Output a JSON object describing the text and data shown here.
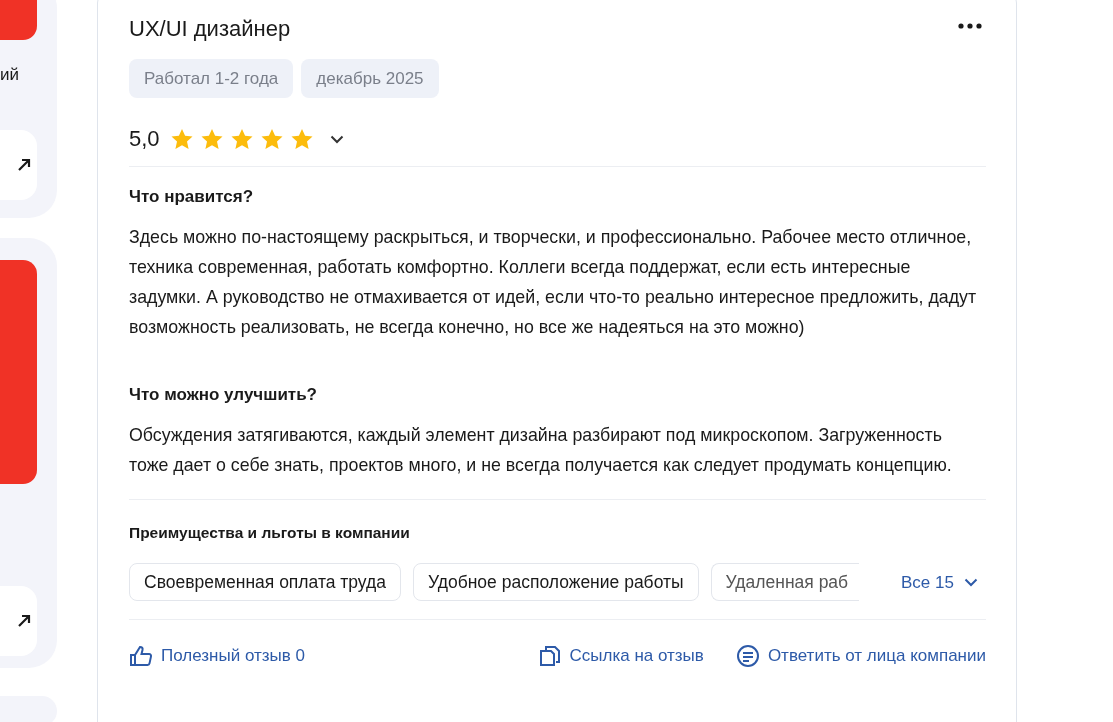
{
  "sidebar": {
    "fragment_text": "ий"
  },
  "review": {
    "title": "UX/UI дизайнер",
    "tags": [
      "Работал 1-2 года",
      "декабрь 2025"
    ],
    "rating": "5,0",
    "stars": 5,
    "sections": [
      {
        "heading": "Что нравится?",
        "text": "Здесь можно по-настоящему раскрыться, и творчески, и профессионально. Рабочее место отличное, техника современная, работать комфортно. Коллеги всегда поддержат, если есть интересные задумки. А руководство не отмахивается от идей, если что-то реально интересное предложить, дадут возможность реализовать, не всегда конечно, но все же надеяться на это можно)"
      },
      {
        "heading": "Что можно улучшить?",
        "text": "Обсуждения затягиваются, каждый элемент дизайна разбирают под микроскопом. Загруженность тоже дает о себе знать, проектов много, и не всегда получается как следует продумать концепцию."
      }
    ],
    "benefits": {
      "heading": "Преимущества и льготы в компании",
      "items": [
        "Своевременная оплата труда",
        "Удобное расположение работы",
        "Удаленная раб"
      ],
      "more": "Все 15"
    },
    "actions": {
      "helpful": "Полезный отзыв 0",
      "link": "Ссылка на отзыв",
      "reply": "Ответить от лица компании"
    }
  }
}
